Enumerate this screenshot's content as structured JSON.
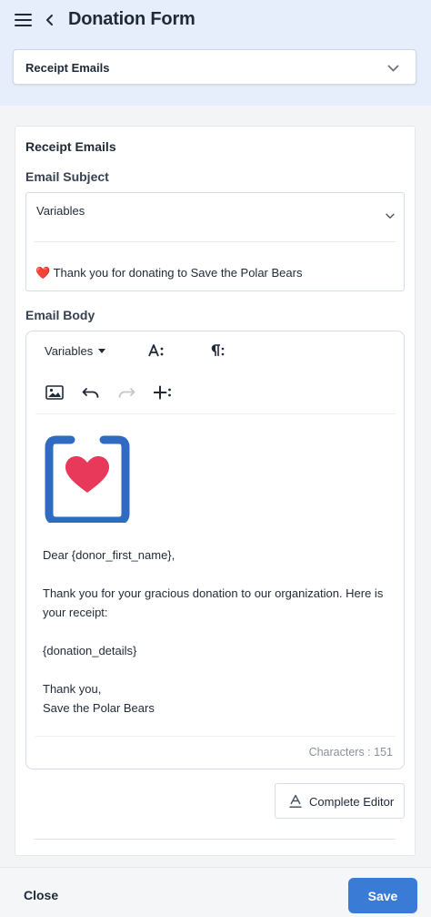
{
  "header": {
    "title": "Donation Form",
    "section_select": "Receipt Emails"
  },
  "card": {
    "title": "Receipt Emails",
    "subject": {
      "label": "Email Subject",
      "variables_label": "Variables",
      "value": "❤️ Thank you for donating to Save the Polar Bears"
    },
    "body": {
      "label": "Email Body",
      "toolbar": {
        "variables_label": "Variables"
      },
      "greeting": "Dear {donor_first_name},",
      "paragraph": "Thank you for your gracious donation to our organization. Here is your receipt:",
      "details": "{donation_details}",
      "signoff": "Thank you,",
      "signature": "Save the Polar Bears",
      "char_count": "Characters : 151"
    },
    "complete_editor_label": "Complete Editor"
  },
  "actions": {
    "close_label": "Close",
    "save_label": "Save"
  },
  "colors": {
    "header_bg": "#e7eefb",
    "primary": "#3a7bd5",
    "logo_blue": "#2f6bc2",
    "heart": "#e8395a"
  }
}
